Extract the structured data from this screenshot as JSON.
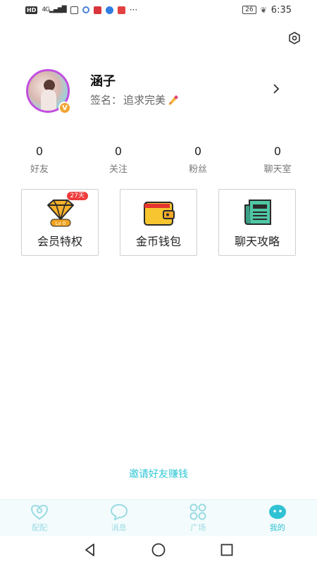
{
  "status_bar": {
    "network": "4G",
    "battery": "26",
    "time": "6:35"
  },
  "profile": {
    "nickname": "涵子",
    "signature_label": "签名：",
    "signature_text": "追求完美",
    "badge": "V"
  },
  "stats": [
    {
      "value": "0",
      "label": "好友"
    },
    {
      "value": "0",
      "label": "关注"
    },
    {
      "value": "0",
      "label": "粉丝"
    },
    {
      "value": "0",
      "label": "聊天室"
    }
  ],
  "cards": [
    {
      "label": "会员特权",
      "badge": "27天",
      "level": "Lv 0"
    },
    {
      "label": "金币钱包"
    },
    {
      "label": "聊天攻略"
    }
  ],
  "invite_link": "邀请好友赚钱",
  "tabs": [
    {
      "label": "配配",
      "active": false
    },
    {
      "label": "消息",
      "active": false
    },
    {
      "label": "广场",
      "active": false
    },
    {
      "label": "我的",
      "active": true
    }
  ],
  "colors": {
    "accent": "#2fc2d3",
    "tab_inactive": "#9adbe3",
    "badge_red": "#ef3b3b",
    "vip_gold": "#f2a531"
  }
}
